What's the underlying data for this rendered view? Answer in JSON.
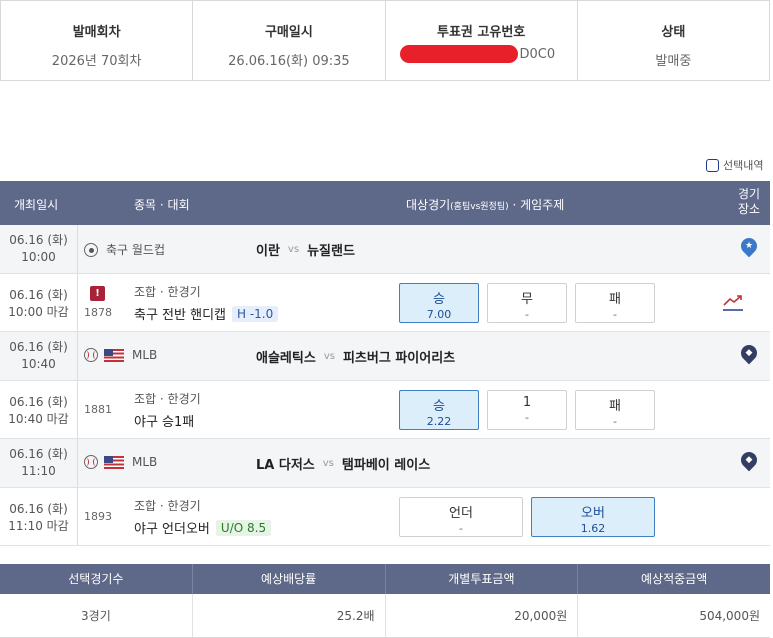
{
  "info": [
    {
      "label": "발매회차",
      "value": "2026년 70회차"
    },
    {
      "label": "구매일시",
      "value": "26.06.16(화) 09:35"
    },
    {
      "label": "투표권 고유번호",
      "value": "D0C0"
    },
    {
      "label": "상태",
      "value": "발매중"
    }
  ],
  "checkbox_label": "선택내역",
  "headers": {
    "date": "개최일시",
    "event": "종목 · 대회",
    "match": "대상경기",
    "match_sub": "(홈팀vs원정팀)",
    "match_tail": " · 게임주제",
    "venue_1": "경기",
    "venue_2": "장소"
  },
  "games": [
    {
      "date": "06.16 (화)",
      "time": "10:00",
      "sport": "축구 월드컵",
      "home": "이란",
      "vs": "vs",
      "away": "뉴질랜드",
      "bet_date": "06.16 (화)",
      "bet_time": "10:00 마감",
      "bet_num": "1878",
      "warn": "!",
      "bet_type": "조합 · 한경기",
      "bet_name": "축구 전반 핸디캡",
      "tag": "H -1.0",
      "options": [
        {
          "label": "승",
          "odds": "7.00",
          "selected": true
        },
        {
          "label": "무",
          "odds": "-",
          "selected": false
        },
        {
          "label": "패",
          "odds": "-",
          "selected": false
        }
      ]
    },
    {
      "date": "06.16 (화)",
      "time": "10:40",
      "sport": "MLB",
      "home": "애슬레틱스",
      "vs": "vs",
      "away": "피츠버그 파이어리츠",
      "bet_date": "06.16 (화)",
      "bet_time": "10:40 마감",
      "bet_num": "1881",
      "bet_type": "조합 · 한경기",
      "bet_name": "야구 승1패",
      "tag": "",
      "options": [
        {
          "label": "승",
          "odds": "2.22",
          "selected": true
        },
        {
          "label": "1",
          "odds": "-",
          "selected": false
        },
        {
          "label": "패",
          "odds": "-",
          "selected": false
        }
      ]
    },
    {
      "date": "06.16 (화)",
      "time": "11:10",
      "sport": "MLB",
      "home": "LA 다저스",
      "vs": "vs",
      "away": "탬파베이 레이스",
      "bet_date": "06.16 (화)",
      "bet_time": "11:10 마감",
      "bet_num": "1893",
      "bet_type": "조합 · 한경기",
      "bet_name": "야구 언더오버",
      "tag": "U/O 8.5",
      "options": [
        {
          "label": "언더",
          "odds": "-",
          "selected": false
        },
        {
          "label": "오버",
          "odds": "1.62",
          "selected": true
        }
      ]
    }
  ],
  "summary": {
    "headers": [
      "선택경기수",
      "예상배당률",
      "개별투표금액",
      "예상적중금액"
    ],
    "values": [
      "3경기",
      "25.2배",
      "20,000원",
      "504,000원"
    ]
  },
  "colors": {
    "header_bg": "#5e6889",
    "selected_bg": "#dbeefa",
    "selected_border": "#3f7fc2",
    "redact": "#e8202a"
  },
  "icons": [
    "soccer-ball-icon",
    "baseball-icon",
    "us-flag-icon",
    "warning-icon",
    "location-pin-icon",
    "star-pin-icon",
    "trend-chart-icon"
  ]
}
